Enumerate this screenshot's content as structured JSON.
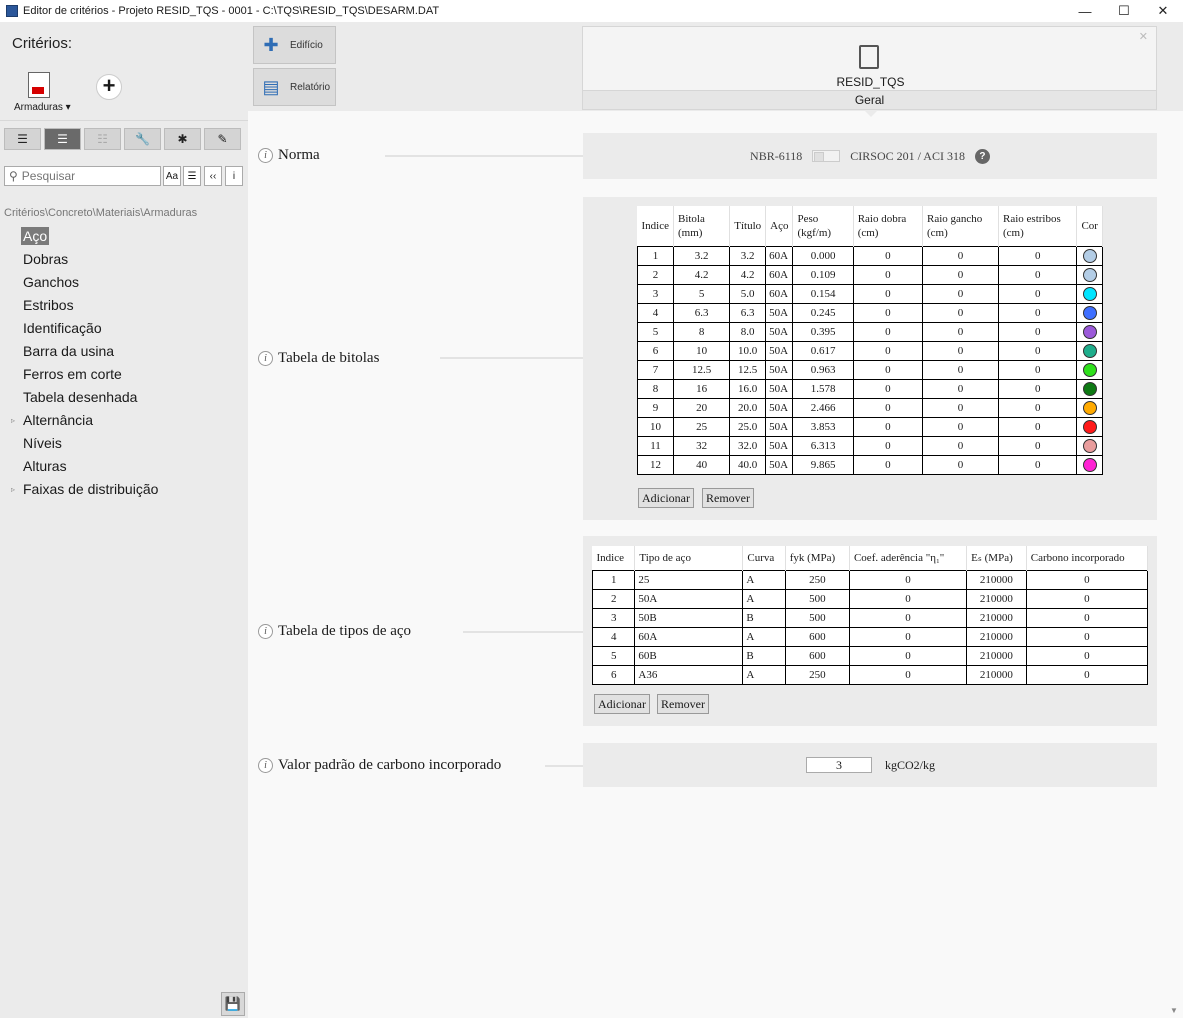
{
  "window": {
    "title": "Editor de critérios - Projeto RESID_TQS - 0001 - C:\\TQS\\RESID_TQS\\DESARM.DAT",
    "minimize": "—",
    "maximize": "☐",
    "close": "✕"
  },
  "sidebar": {
    "title": "Critérios:",
    "armaduras_label": "Armaduras ▾",
    "add_symbol": "+",
    "toolbar": [
      "☰",
      "☰",
      "☷",
      "🔧",
      "✱",
      "✎"
    ],
    "search_placeholder": "Pesquisar",
    "search_opts": [
      "Aa",
      "☰",
      "‹‹",
      "i"
    ],
    "breadcrumb": "Critérios\\Concreto\\Materiais\\Armaduras",
    "tree": [
      {
        "label": "Aço"
      },
      {
        "label": "Dobras"
      },
      {
        "label": "Ganchos"
      },
      {
        "label": "Estribos"
      },
      {
        "label": "Identificação"
      },
      {
        "label": "Barra da usina"
      },
      {
        "label": "Ferros em corte"
      },
      {
        "label": "Tabela desenhada"
      },
      {
        "label": "Alternância"
      },
      {
        "label": "Níveis"
      },
      {
        "label": "Alturas"
      },
      {
        "label": "Faixas de distribuição"
      }
    ],
    "tree_arrow": "▹"
  },
  "topnav": {
    "edificio": "Edifício",
    "relatorio": "Relatório",
    "resid_name": "RESID_TQS",
    "resid_tab": "Geral",
    "close": "✕"
  },
  "sections": {
    "norma": {
      "label": "Norma",
      "option_a": "NBR-6118",
      "option_b": "CIRSOC 201 / ACI 318",
      "help": "?"
    },
    "bitolas": {
      "label": "Tabela de bitolas",
      "headers": [
        "Indice",
        "Bitola (mm)",
        "Título",
        "Aço",
        "Peso (kgf/m)",
        "Raio dobra (cm)",
        "Raio gancho (cm)",
        "Raio estribos (cm)",
        "Cor"
      ],
      "rows": [
        {
          "indice": "1",
          "bitola": "3.2",
          "titulo": "3.2",
          "aco": "60A",
          "peso": "0.000",
          "rd": "0",
          "rg": "0",
          "re": "0",
          "cor": "#b3cde6"
        },
        {
          "indice": "2",
          "bitola": "4.2",
          "titulo": "4.2",
          "aco": "60A",
          "peso": "0.109",
          "rd": "0",
          "rg": "0",
          "re": "0",
          "cor": "#b3cde6"
        },
        {
          "indice": "3",
          "bitola": "5",
          "titulo": "5.0",
          "aco": "60A",
          "peso": "0.154",
          "rd": "0",
          "rg": "0",
          "re": "0",
          "cor": "#00e5ff"
        },
        {
          "indice": "4",
          "bitola": "6.3",
          "titulo": "6.3",
          "aco": "50A",
          "peso": "0.245",
          "rd": "0",
          "rg": "0",
          "re": "0",
          "cor": "#3f6fff"
        },
        {
          "indice": "5",
          "bitola": "8",
          "titulo": "8.0",
          "aco": "50A",
          "peso": "0.395",
          "rd": "0",
          "rg": "0",
          "re": "0",
          "cor": "#9b59d9"
        },
        {
          "indice": "6",
          "bitola": "10",
          "titulo": "10.0",
          "aco": "50A",
          "peso": "0.617",
          "rd": "0",
          "rg": "0",
          "re": "0",
          "cor": "#1fae8c"
        },
        {
          "indice": "7",
          "bitola": "12.5",
          "titulo": "12.5",
          "aco": "50A",
          "peso": "0.963",
          "rd": "0",
          "rg": "0",
          "re": "0",
          "cor": "#2fe01c"
        },
        {
          "indice": "8",
          "bitola": "16",
          "titulo": "16.0",
          "aco": "50A",
          "peso": "1.578",
          "rd": "0",
          "rg": "0",
          "re": "0",
          "cor": "#0e7a14"
        },
        {
          "indice": "9",
          "bitola": "20",
          "titulo": "20.0",
          "aco": "50A",
          "peso": "2.466",
          "rd": "0",
          "rg": "0",
          "re": "0",
          "cor": "#ffaa00"
        },
        {
          "indice": "10",
          "bitola": "25",
          "titulo": "25.0",
          "aco": "50A",
          "peso": "3.853",
          "rd": "0",
          "rg": "0",
          "re": "0",
          "cor": "#ff1a1a"
        },
        {
          "indice": "11",
          "bitola": "32",
          "titulo": "32.0",
          "aco": "50A",
          "peso": "6.313",
          "rd": "0",
          "rg": "0",
          "re": "0",
          "cor": "#e99d9d"
        },
        {
          "indice": "12",
          "bitola": "40",
          "titulo": "40.0",
          "aco": "50A",
          "peso": "9.865",
          "rd": "0",
          "rg": "0",
          "re": "0",
          "cor": "#ff22d4"
        }
      ],
      "add": "Adicionar",
      "remove": "Remover"
    },
    "tipos": {
      "label": "Tabela de tipos de aço",
      "headers": [
        "Indice",
        "Tipo de aço",
        "Curva",
        "fyk (MPa)",
        "Coef. aderência \"η₁\"",
        "Eₛ (MPa)",
        "Carbono incorporado"
      ],
      "rows": [
        {
          "indice": "1",
          "tipo": "25",
          "curva": "A",
          "fyk": "250",
          "coef": "0",
          "es": "210000",
          "carbono": "0"
        },
        {
          "indice": "2",
          "tipo": "50A",
          "curva": "A",
          "fyk": "500",
          "coef": "0",
          "es": "210000",
          "carbono": "0"
        },
        {
          "indice": "3",
          "tipo": "50B",
          "curva": "B",
          "fyk": "500",
          "coef": "0",
          "es": "210000",
          "carbono": "0"
        },
        {
          "indice": "4",
          "tipo": "60A",
          "curva": "A",
          "fyk": "600",
          "coef": "0",
          "es": "210000",
          "carbono": "0"
        },
        {
          "indice": "5",
          "tipo": "60B",
          "curva": "B",
          "fyk": "600",
          "coef": "0",
          "es": "210000",
          "carbono": "0"
        },
        {
          "indice": "6",
          "tipo": "A36",
          "curva": "A",
          "fyk": "250",
          "coef": "0",
          "es": "210000",
          "carbono": "0"
        }
      ],
      "add": "Adicionar",
      "remove": "Remover"
    },
    "carbono": {
      "label": "Valor padrão de carbono incorporado",
      "value": "3",
      "unit": "kgCO2/kg"
    }
  }
}
